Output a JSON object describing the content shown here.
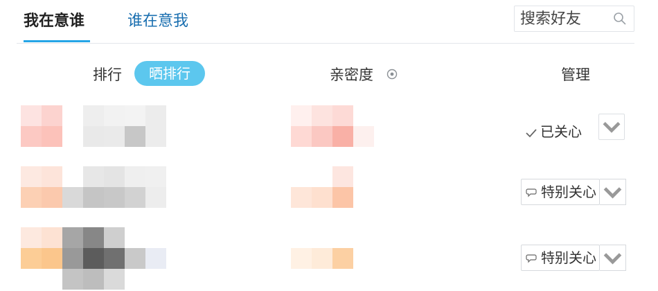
{
  "tabs": [
    {
      "label": "我在意谁",
      "active": true
    },
    {
      "label": "谁在意我",
      "active": false
    }
  ],
  "search": {
    "placeholder": "搜索好友"
  },
  "columns": {
    "rank": "排行",
    "rank_button": "晒排行",
    "intimacy": "亲密度",
    "manage": "管理"
  },
  "rows": [
    {
      "status_label": "已关心",
      "status_type": "checked"
    },
    {
      "status_label": "特别关心",
      "status_type": "special"
    },
    {
      "status_label": "特别关心",
      "status_type": "special"
    }
  ],
  "colors": {
    "accent": "#25a5e6",
    "rank_button_bg": "#5cc7ee",
    "tab_inactive": "#1a6fb0"
  }
}
